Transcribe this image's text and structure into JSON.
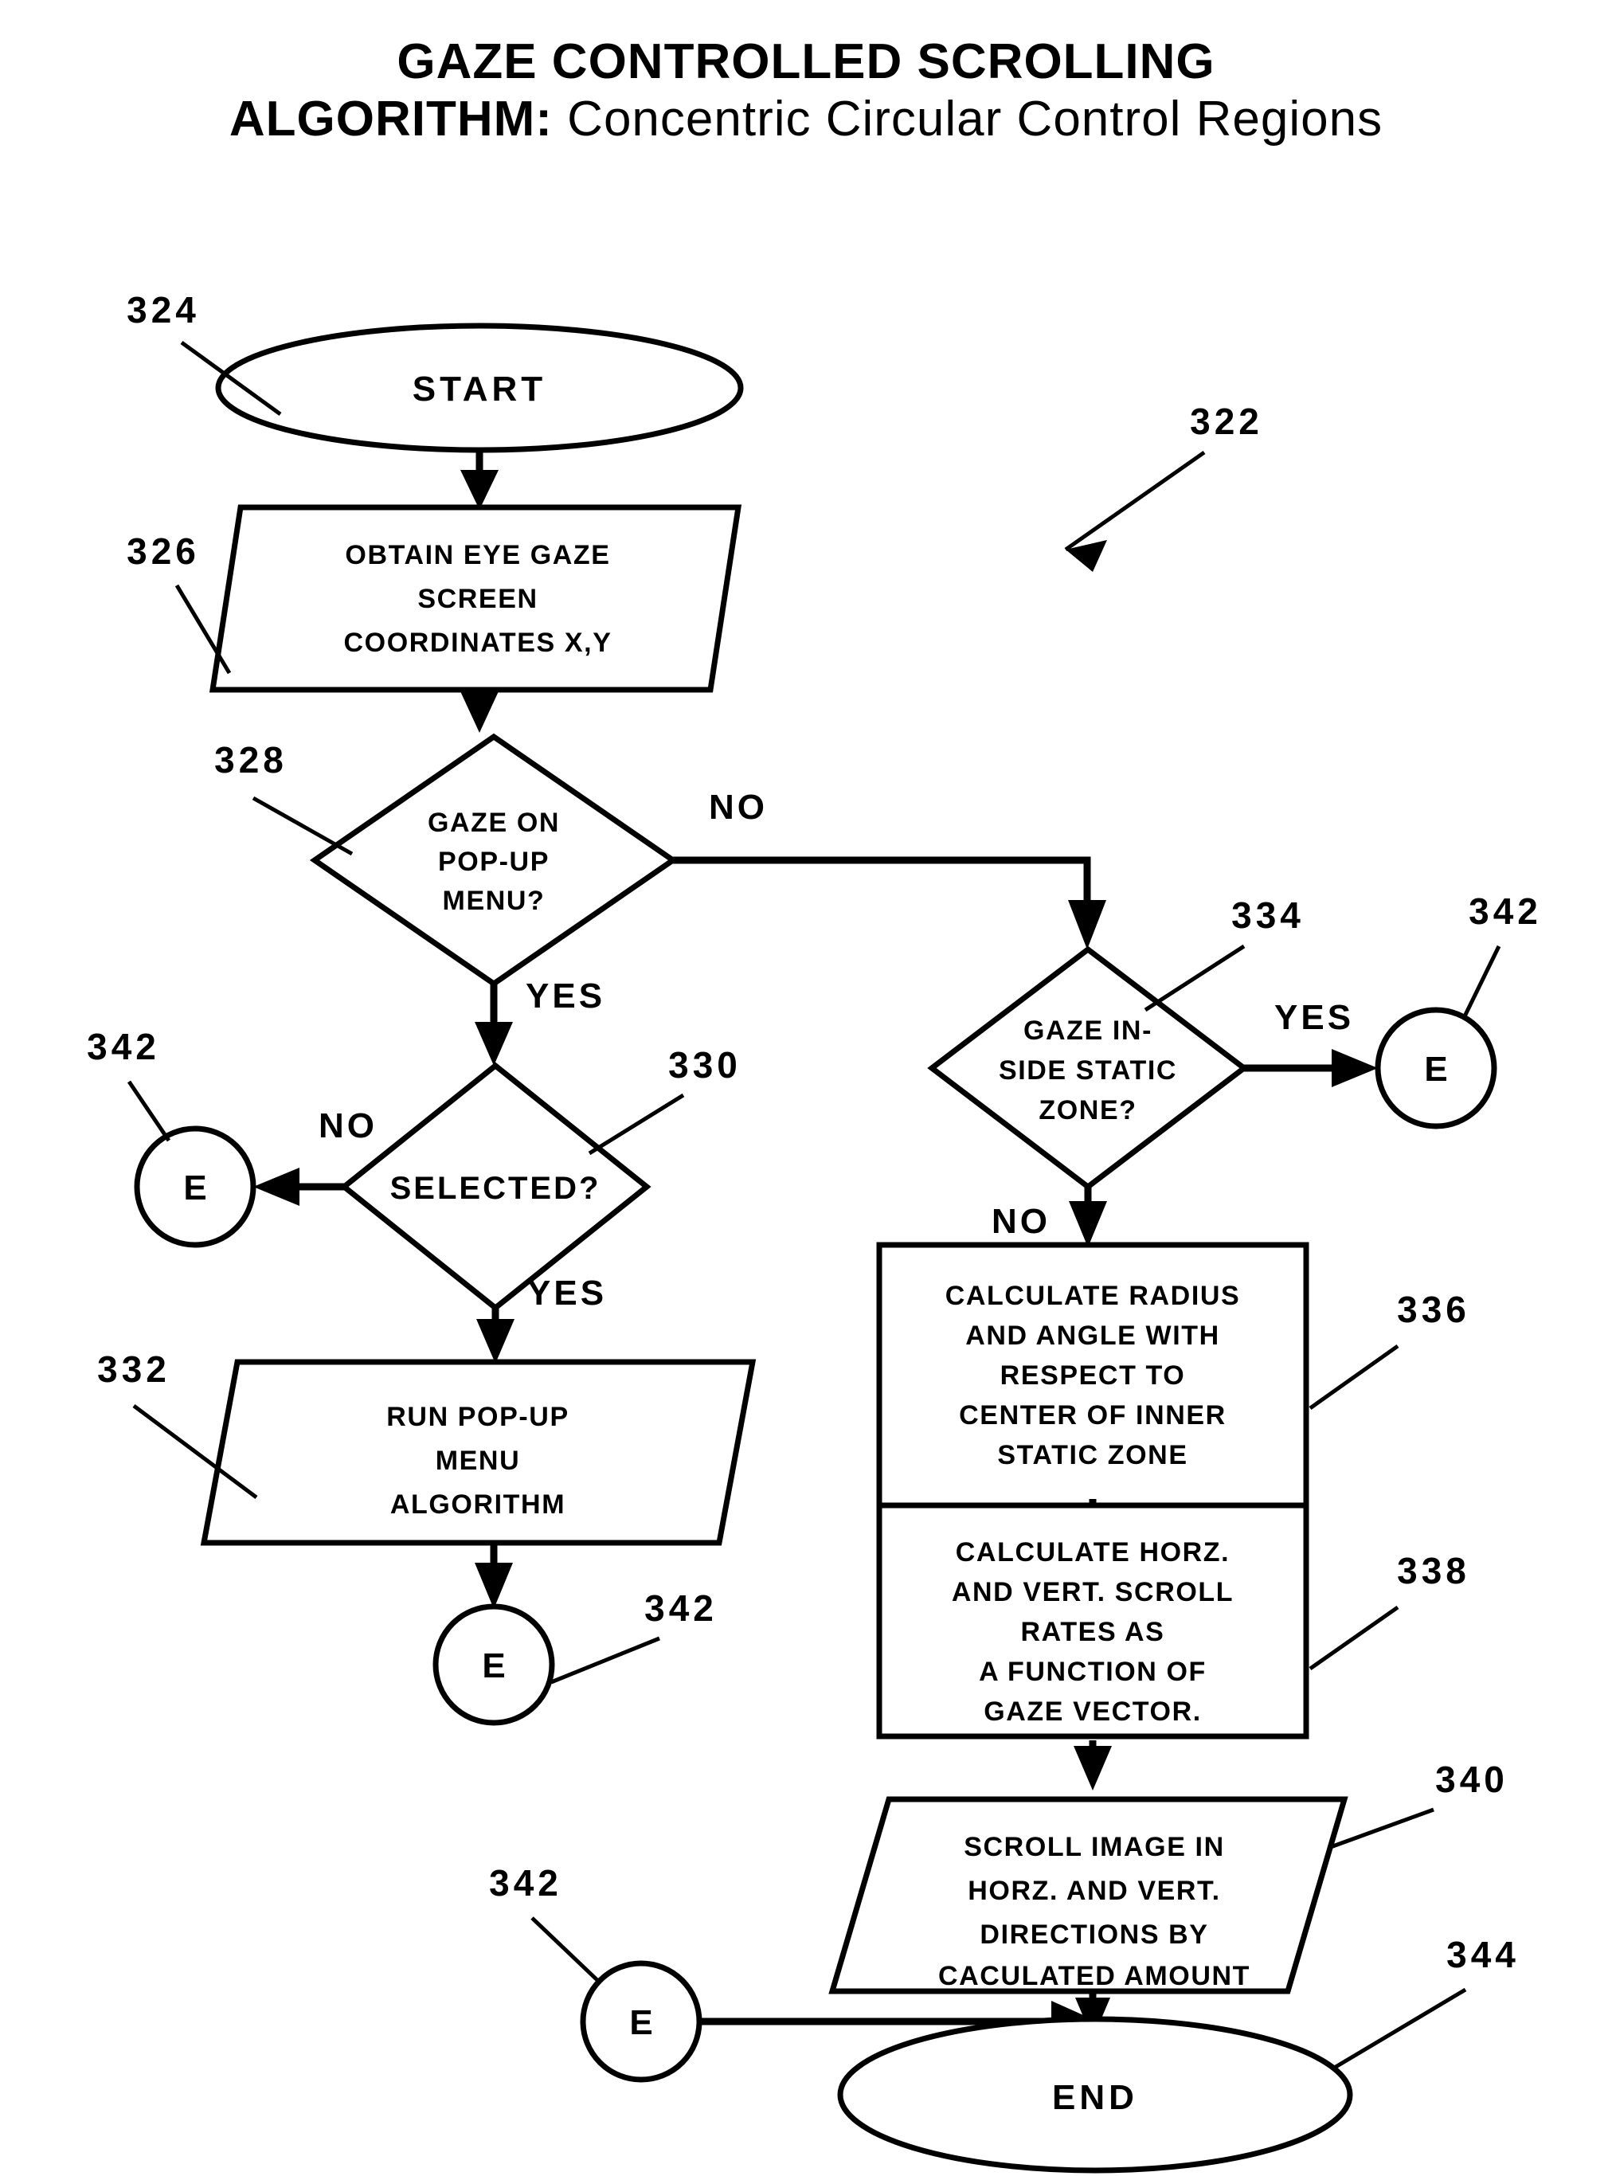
{
  "title": {
    "line1": "GAZE CONTROLLED SCROLLING",
    "line2_bold": "ALGORITHM:",
    "line2_rest": " Concentric Circular Control Regions"
  },
  "figure_ref": "322",
  "nodes": {
    "start": {
      "ref": "324",
      "label": "START",
      "shape": "ellipse"
    },
    "obtain_gaze": {
      "ref": "326",
      "shape": "parallelogram",
      "lines": [
        "OBTAIN  EYE  GAZE",
        "SCREEN",
        "COORDINATES  X,Y"
      ]
    },
    "gaze_on_popup": {
      "ref": "328",
      "shape": "diamond",
      "lines": [
        "GAZE ON",
        "POP-UP",
        "MENU?"
      ]
    },
    "selected": {
      "ref": "330",
      "shape": "diamond",
      "lines": [
        "SELECTED?"
      ]
    },
    "run_popup": {
      "ref": "332",
      "shape": "parallelogram",
      "lines": [
        "RUN POP-UP",
        "MENU",
        "ALGORITHM"
      ]
    },
    "gaze_inside_static": {
      "ref": "334",
      "shape": "diamond",
      "lines": [
        "GAZE IN-",
        "SIDE  STATIC",
        "ZONE?"
      ]
    },
    "calc_radius": {
      "ref": "336",
      "shape": "rectangle",
      "lines": [
        "CALCULATE  RADIUS",
        "AND ANGLE WITH",
        "RESPECT TO",
        "CENTER  OF  INNER",
        "STATIC ZONE"
      ]
    },
    "calc_rates": {
      "ref": "338",
      "shape": "rectangle",
      "lines": [
        "CALCULATE HORZ.",
        "AND  VERT.  SCROLL",
        "RATES AS",
        "A FUNCTION OF",
        "GAZE VECTOR."
      ]
    },
    "scroll_image": {
      "ref": "340",
      "shape": "parallelogram",
      "lines": [
        "SCROLL IMAGE IN",
        "HORZ. AND VERT.",
        "DIRECTIONS BY",
        "CACULATED  AMOUNT"
      ]
    },
    "end": {
      "ref": "344",
      "label": "END",
      "shape": "ellipse"
    }
  },
  "connectors": {
    "e_left": {
      "ref": "342",
      "label": "E"
    },
    "e_popup": {
      "ref": "342",
      "label": "E"
    },
    "e_static": {
      "ref": "342",
      "label": "E"
    },
    "e_bottom": {
      "ref": "342",
      "label": "E"
    }
  },
  "edge_labels": {
    "popup_no": "NO",
    "popup_yes": "YES",
    "selected_no": "NO",
    "selected_yes": "YES",
    "static_yes": "YES",
    "static_no": "NO"
  },
  "colors": {
    "stroke": "#000000",
    "background": "#ffffff"
  }
}
